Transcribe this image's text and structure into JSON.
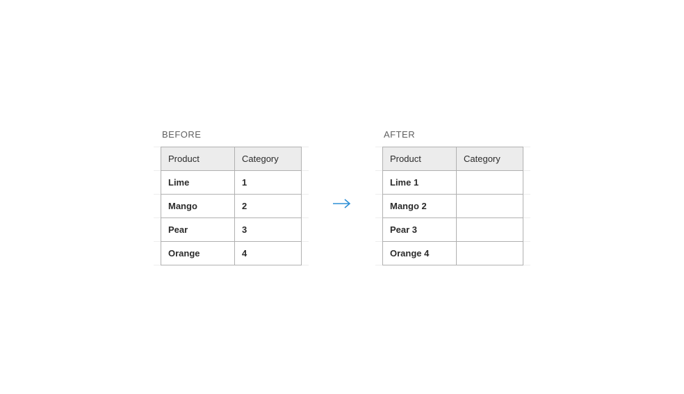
{
  "labels": {
    "before": "BEFORE",
    "after": "AFTER"
  },
  "headers": {
    "product": "Product",
    "category": "Category"
  },
  "before": {
    "rows": [
      {
        "product": "Lime",
        "category": "1"
      },
      {
        "product": "Mango",
        "category": "2"
      },
      {
        "product": "Pear",
        "category": "3"
      },
      {
        "product": "Orange",
        "category": "4"
      }
    ]
  },
  "after": {
    "rows": [
      {
        "product": "Lime 1",
        "category": ""
      },
      {
        "product": "Mango 2",
        "category": ""
      },
      {
        "product": "Pear 3",
        "category": ""
      },
      {
        "product": "Orange 4",
        "category": ""
      }
    ]
  },
  "arrow_color": "#2d8fd6"
}
